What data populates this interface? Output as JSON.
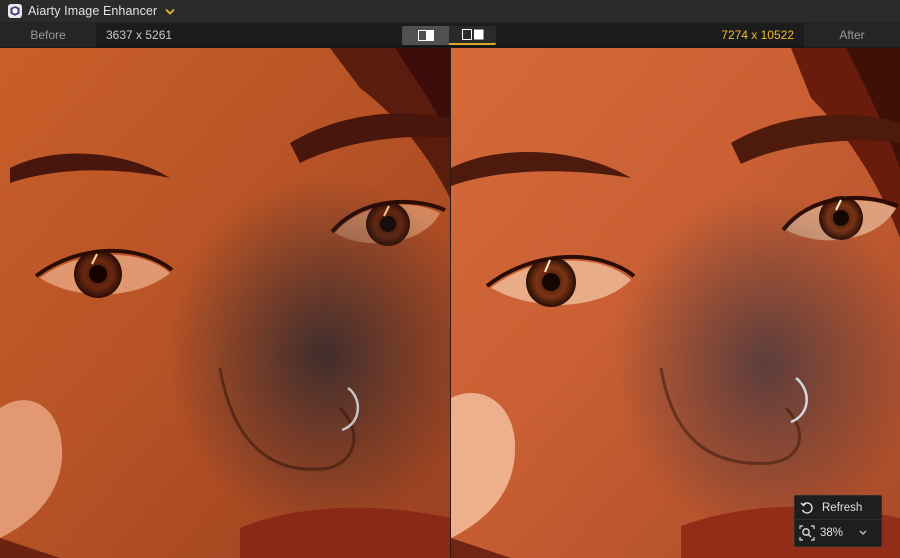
{
  "app": {
    "title": "Aiarty Image Enhancer",
    "logo_icon": "aiarty-logo-icon",
    "title_menu_icon": "chevron-down-icon",
    "accent_color": "#f0b72d"
  },
  "toolbar": {
    "before_label": "Before",
    "before_resolution": "3637 x 5261",
    "after_resolution": "7274 x 10522",
    "after_label": "After",
    "view_modes": [
      {
        "name": "single-view",
        "icon": "single-view-icon",
        "selected": false
      },
      {
        "name": "side-by-side-view",
        "icon": "split-view-icon",
        "selected": true
      }
    ]
  },
  "zoom_panel": {
    "refresh_label": "Refresh",
    "refresh_icon": "refresh-icon",
    "zoom_icon": "zoom-fit-icon",
    "zoom_value": "38%",
    "zoom_menu_icon": "chevron-down-icon"
  }
}
